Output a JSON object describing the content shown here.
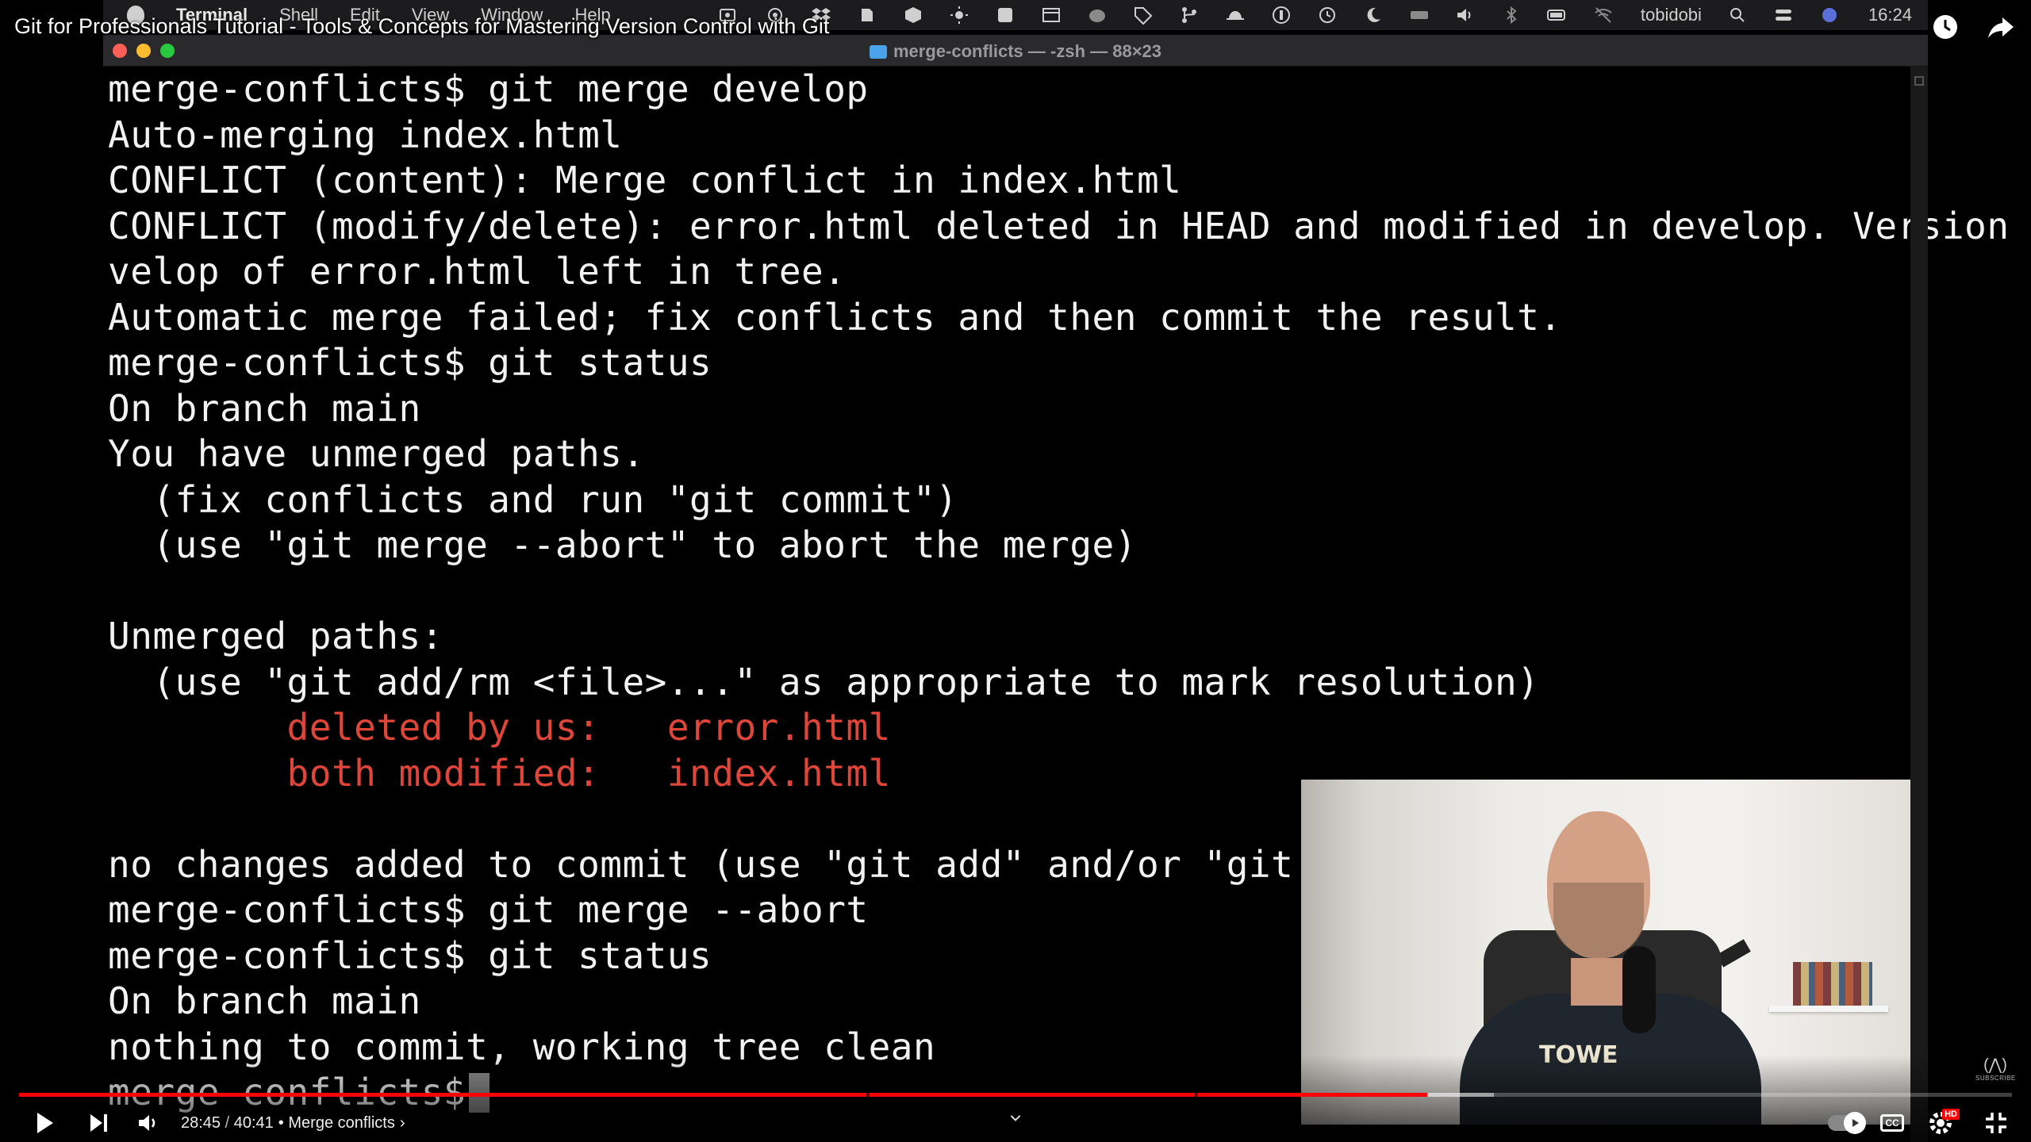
{
  "video": {
    "title": "Git for Professionals Tutorial - Tools & Concepts for Mastering Version Control with Git"
  },
  "mac_menubar": {
    "app_name": "Terminal",
    "menus": [
      "Shell",
      "Edit",
      "View",
      "Window",
      "Help"
    ],
    "username": "tobidobi",
    "clock": "16:24"
  },
  "terminal": {
    "window_title": "merge-conflicts — -zsh — 88×23",
    "lines": [
      {
        "text": "merge-conflicts$ git merge develop",
        "color": "#f2f2f2"
      },
      {
        "text": "Auto-merging index.html",
        "color": "#f2f2f2"
      },
      {
        "text": "CONFLICT (content): Merge conflict in index.html",
        "color": "#f2f2f2"
      },
      {
        "text": "CONFLICT (modify/delete): error.html deleted in HEAD and modified in develop. Version de",
        "color": "#f2f2f2"
      },
      {
        "text": "velop of error.html left in tree.",
        "color": "#f2f2f2"
      },
      {
        "text": "Automatic merge failed; fix conflicts and then commit the result.",
        "color": "#f2f2f2"
      },
      {
        "text": "merge-conflicts$ git status",
        "color": "#f2f2f2"
      },
      {
        "text": "On branch main",
        "color": "#f2f2f2"
      },
      {
        "text": "You have unmerged paths.",
        "color": "#f2f2f2"
      },
      {
        "text": "  (fix conflicts and run \"git commit\")",
        "color": "#f2f2f2"
      },
      {
        "text": "  (use \"git merge --abort\" to abort the merge)",
        "color": "#f2f2f2"
      },
      {
        "text": "",
        "color": "#f2f2f2"
      },
      {
        "text": "Unmerged paths:",
        "color": "#f2f2f2"
      },
      {
        "text": "  (use \"git add/rm <file>...\" as appropriate to mark resolution)",
        "color": "#f2f2f2"
      },
      {
        "text": "        deleted by us:   error.html",
        "color": "#e0453a"
      },
      {
        "text": "        both modified:   index.html",
        "color": "#e0453a"
      },
      {
        "text": "",
        "color": "#f2f2f2"
      },
      {
        "text": "no changes added to commit (use \"git add\" and/or \"git commi",
        "color": "#f2f2f2"
      },
      {
        "text": "merge-conflicts$ git merge --abort",
        "color": "#f2f2f2"
      },
      {
        "text": "merge-conflicts$ git status",
        "color": "#f2f2f2"
      },
      {
        "text": "On branch main",
        "color": "#f2f2f2"
      },
      {
        "text": "nothing to commit, working tree clean",
        "color": "#f2f2f2"
      },
      {
        "text": "merge-conflicts$",
        "color": "#f2f2f2",
        "cursor": true
      }
    ]
  },
  "webcam": {
    "shirt_text": "TOWE"
  },
  "player": {
    "current_time": "28:45",
    "duration": "40:41",
    "time_separator": " / ",
    "chapter_prefix": "•",
    "chapter": "Merge conflicts",
    "chapter_chevron": "›",
    "played_fraction": 0.7066,
    "buffered_fraction": 0.74,
    "chapter_fractions": [
      0.425,
      0.59
    ],
    "hd_badge": "HD",
    "cc_label": "CC",
    "accent_color": "#ff0000",
    "icons": {
      "play": "play-icon",
      "next": "next-icon",
      "volume": "volume-icon",
      "autoplay": "autoplay-toggle-icon",
      "cc": "captions-icon",
      "settings": "gear-icon",
      "exit_fullscreen": "exit-fullscreen-icon",
      "watch_later": "clock-icon",
      "share": "share-icon"
    }
  }
}
